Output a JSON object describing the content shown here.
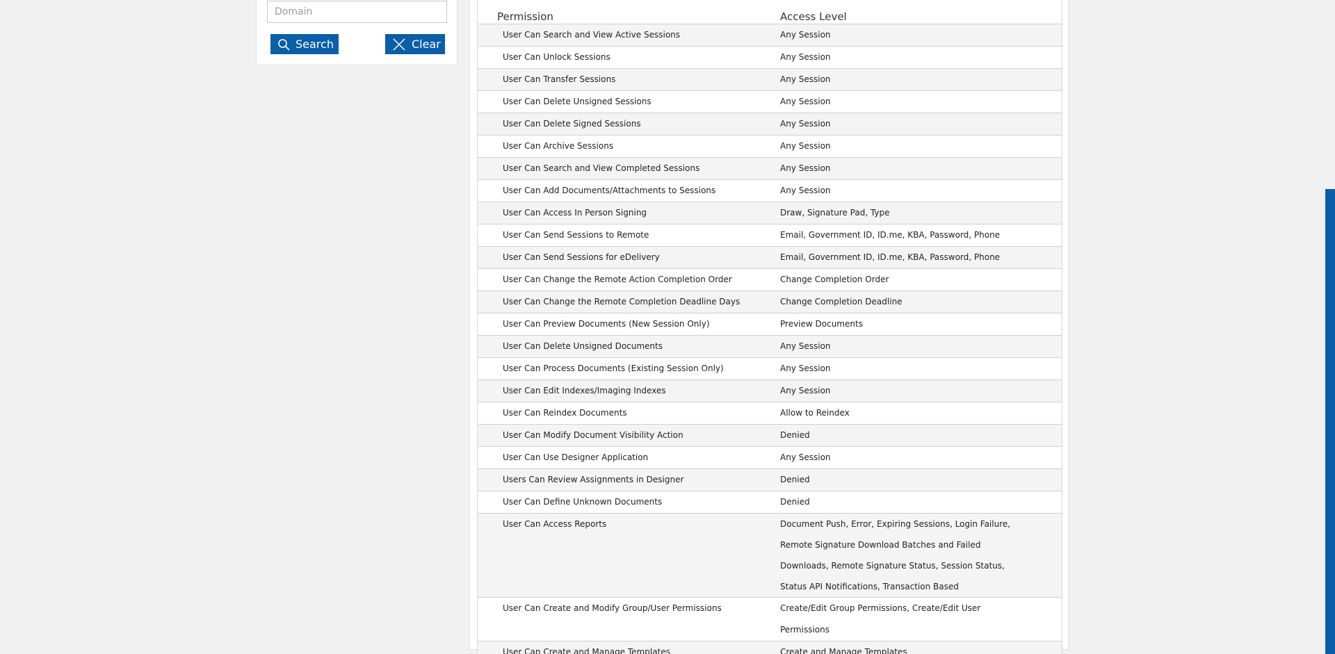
{
  "filter": {
    "domain_placeholder": "Domain",
    "domain_value": "",
    "search_label": "Search",
    "clear_label": "Clear"
  },
  "table": {
    "header_permission": "Permission",
    "header_access": "Access Level",
    "rows": [
      {
        "permission": "User Can Search and View Active Sessions",
        "access": "Any Session"
      },
      {
        "permission": "User Can Unlock Sessions",
        "access": "Any Session"
      },
      {
        "permission": "User Can Transfer Sessions",
        "access": "Any Session"
      },
      {
        "permission": "User Can Delete Unsigned Sessions",
        "access": "Any Session"
      },
      {
        "permission": "User Can Delete Signed Sessions",
        "access": "Any Session"
      },
      {
        "permission": "User Can Archive Sessions",
        "access": "Any Session"
      },
      {
        "permission": "User Can Search and View Completed Sessions",
        "access": "Any Session"
      },
      {
        "permission": "User Can Add Documents/Attachments to Sessions",
        "access": "Any Session"
      },
      {
        "permission": "User Can Access In Person Signing",
        "access": "Draw, Signature Pad, Type"
      },
      {
        "permission": "User Can Send Sessions to Remote",
        "access": "Email, Government ID, ID.me, KBA, Password, Phone"
      },
      {
        "permission": "User Can Send Sessions for eDelivery",
        "access": "Email, Government ID, ID.me, KBA, Password, Phone"
      },
      {
        "permission": "User Can Change the Remote Action Completion Order",
        "access": "Change Completion Order"
      },
      {
        "permission": "User Can Change the Remote Completion Deadline Days",
        "access": "Change Completion Deadline"
      },
      {
        "permission": "User Can Preview Documents (New Session Only)",
        "access": "Preview Documents"
      },
      {
        "permission": "User Can Delete Unsigned Documents",
        "access": "Any Session"
      },
      {
        "permission": "User Can Process Documents (Existing Session Only)",
        "access": "Any Session"
      },
      {
        "permission": "User Can Edit Indexes/Imaging Indexes",
        "access": "Any Session"
      },
      {
        "permission": "User Can Reindex Documents",
        "access": "Allow to Reindex"
      },
      {
        "permission": "User Can Modify Document Visibility Action",
        "access": "Denied"
      },
      {
        "permission": "User Can Use Designer Application",
        "access": "Any Session"
      },
      {
        "permission": "Users Can Review Assignments in Designer",
        "access": "Denied"
      },
      {
        "permission": "User Can Define Unknown Documents",
        "access": "Denied"
      },
      {
        "permission": "User Can Access Reports",
        "access": "Document Push, Error, Expiring Sessions, Login Failure, Remote Signature Download Batches and Failed Downloads, Remote Signature Status, Session Status, Status API Notifications, Transaction Based"
      },
      {
        "permission": "User Can Create and Modify Group/User Permissions",
        "access": "Create/Edit Group Permissions, Create/Edit User Permissions"
      },
      {
        "permission": "User Can Create and Manage Templates",
        "access": "Create and Manage Templates"
      }
    ]
  },
  "colors": {
    "accent": "#0b5ea8",
    "row_alt": "#f4f4f4",
    "page_bg": "#f1f1f1"
  }
}
